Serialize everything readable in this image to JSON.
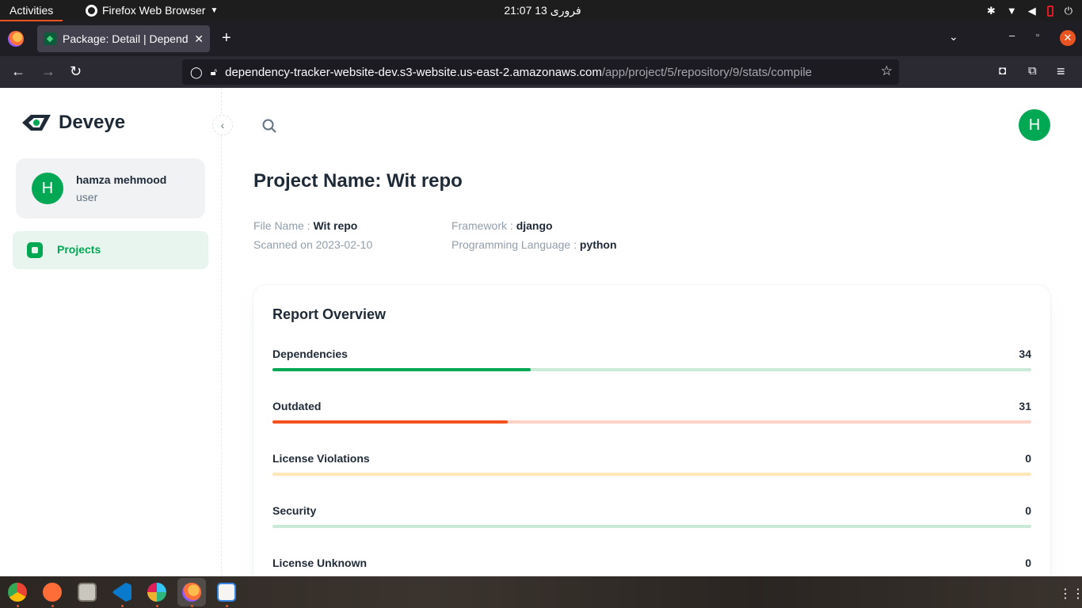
{
  "topbar": {
    "activities": "Activities",
    "app_name": "Firefox Web Browser",
    "clock": "21:07  13 فروری",
    "tray_icons": [
      "slack-icon",
      "wifi-icon",
      "volume-icon",
      "battery-icon",
      "power-icon"
    ]
  },
  "browser": {
    "tab_title": "Package: Detail | Dependency",
    "url_host": "dependency-tracker-website-dev.s3-website.us-east-2.amazonaws.com",
    "url_path": "/app/project/5/repository/9/stats/compile"
  },
  "sidebar": {
    "brand": "Deveye",
    "user": {
      "name": "hamza mehmood",
      "role": "user",
      "initial": "H"
    },
    "nav": [
      {
        "label": "Projects",
        "icon": "projects-icon",
        "active": true
      }
    ]
  },
  "header": {
    "avatar_initial": "H"
  },
  "project": {
    "title": "Project Name: Wit repo",
    "file_name_label": "File Name : ",
    "file_name": "Wit repo",
    "scanned_label": "Scanned on ",
    "scanned_date": "2023-02-10",
    "framework_label": "Framework : ",
    "framework": "django",
    "language_label": "Programming Language : ",
    "language": "python"
  },
  "report": {
    "title": "Report Overview",
    "metrics": [
      {
        "label": "Dependencies",
        "value": "34",
        "progress": 0.34,
        "color": "#00a854",
        "track": "#c8ead7"
      },
      {
        "label": "Outdated",
        "value": "31",
        "progress": 0.31,
        "color": "#f4511e",
        "track": "#fdd3c6"
      },
      {
        "label": "License Violations",
        "value": "0",
        "progress": 0,
        "color": "#ffc107",
        "track": "#ffe7b8"
      },
      {
        "label": "Security",
        "value": "0",
        "progress": 0,
        "color": "#00a854",
        "track": "#c8ead7"
      },
      {
        "label": "License Unknown",
        "value": "0",
        "progress": 0,
        "color": "#00a854",
        "track": "#c8ead7"
      }
    ]
  },
  "dock": {
    "apps": [
      "chrome-icon",
      "postman-icon",
      "files-icon",
      "vscode-icon",
      "slack-icon",
      "firefox-icon",
      "text-editor-icon"
    ]
  }
}
